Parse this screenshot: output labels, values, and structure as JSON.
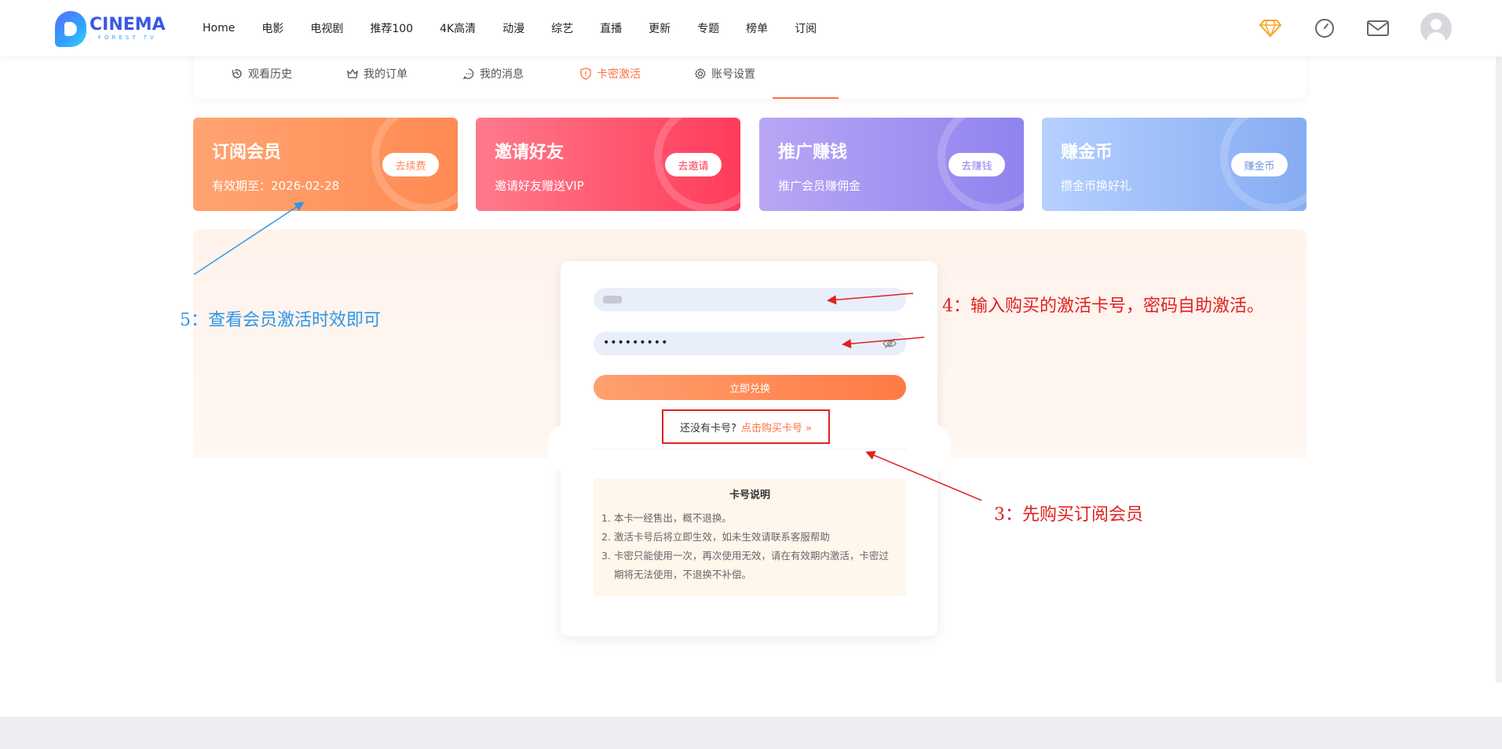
{
  "header": {
    "logo_main": "CINEMA",
    "logo_sub": "FOREST TV",
    "nav": [
      "Home",
      "电影",
      "电视剧",
      "推荐100",
      "4K高清",
      "动漫",
      "综艺",
      "直播",
      "更新",
      "专题",
      "榜单",
      "订阅"
    ],
    "icons": [
      "diamond-icon",
      "clock-icon",
      "mail-icon",
      "avatar"
    ]
  },
  "tabs": {
    "items": [
      "观看历史",
      "我的订单",
      "我的消息",
      "卡密激活",
      "账号设置"
    ],
    "active": "卡密激活"
  },
  "promos": [
    {
      "title": "订阅会员",
      "sub": "有效期至：2026-02-28",
      "button": "去续费",
      "color": "#ff8a52"
    },
    {
      "title": "邀请好友",
      "sub": "邀请好友赠送VIP",
      "button": "去邀请",
      "color": "#ff3b5a"
    },
    {
      "title": "推广赚钱",
      "sub": "推广会员赚佣金",
      "button": "去赚钱",
      "color": "#8f83ee"
    },
    {
      "title": "赚金币",
      "sub": "攒金币换好礼",
      "button": "赚金币",
      "color": "#86acf2"
    }
  ],
  "redeem": {
    "password_value": "•••••••••",
    "submit_label": "立即兑换",
    "no_card_question": "还没有卡号?",
    "buy_link": "点击购买卡号 »",
    "notes_title": "卡号说明",
    "notes": [
      "1. 本卡一经售出，概不退换。",
      "2. 激活卡号后将立即生效，如未生效请联系客服帮助",
      "3. 卡密只能使用一次，再次使用无效，请在有效期内激活，卡密过期将无法使用，不退换不补偿。"
    ]
  },
  "annotations": {
    "step5": "5：查看会员激活时效即可",
    "step4": "4：输入购买的激活卡号，密码自助激活。",
    "step3": "3：先购买订阅会员"
  }
}
